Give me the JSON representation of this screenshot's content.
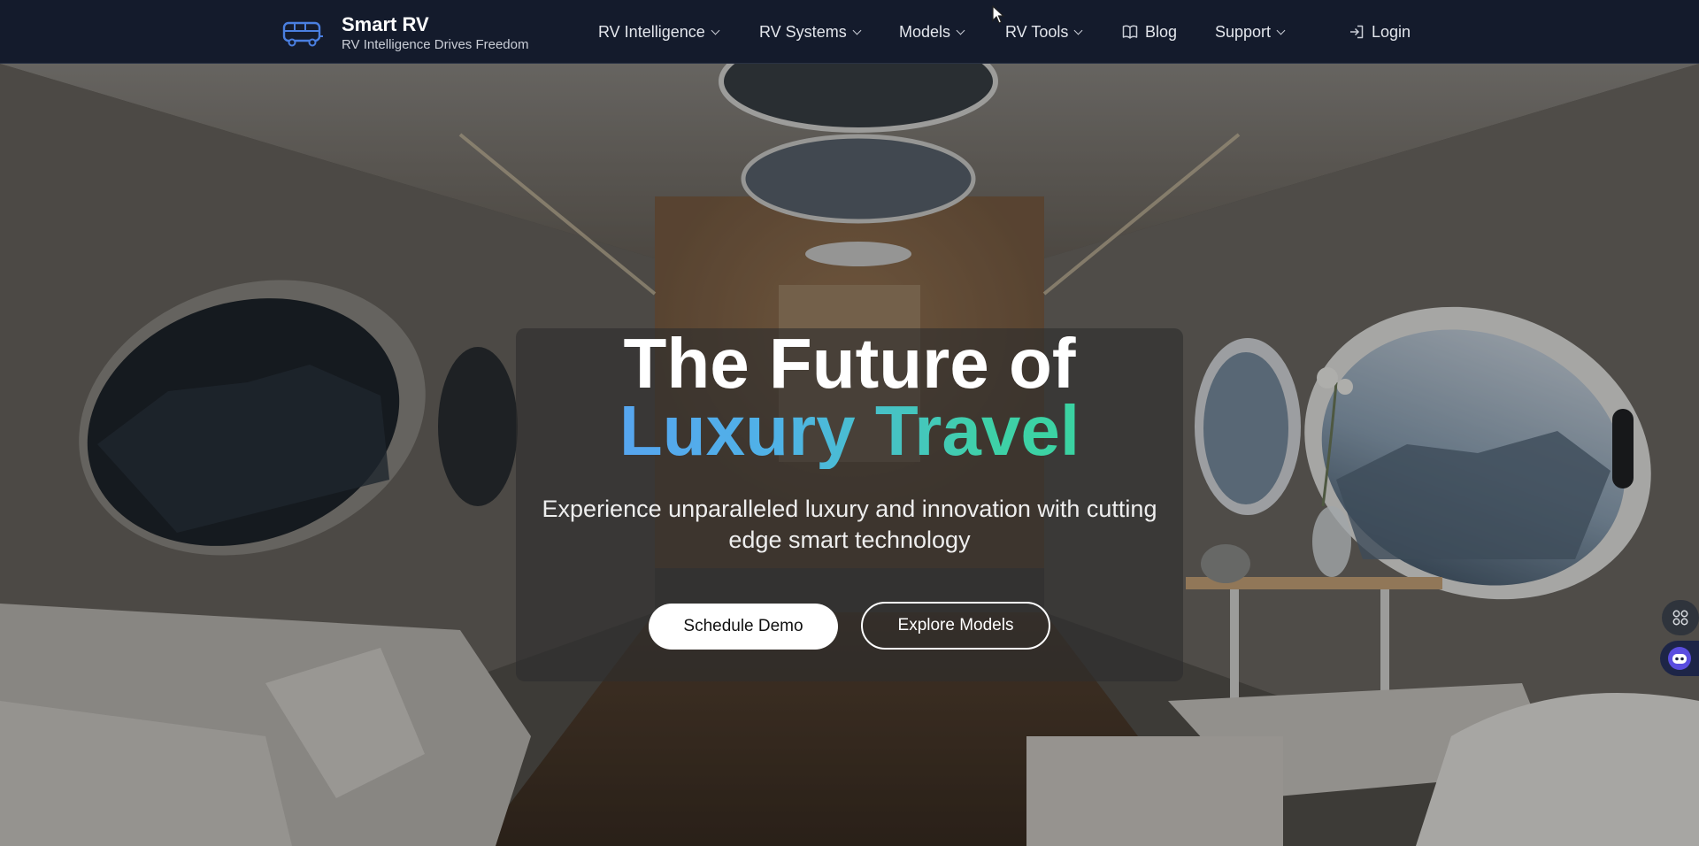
{
  "brand": {
    "title": "Smart RV",
    "tagline": "RV Intelligence Drives Freedom",
    "icon": "rv-bus-icon"
  },
  "nav": {
    "items": [
      {
        "label": "RV Intelligence",
        "has_dropdown": true
      },
      {
        "label": "RV Systems",
        "has_dropdown": true
      },
      {
        "label": "Models",
        "has_dropdown": true
      },
      {
        "label": "RV Tools",
        "has_dropdown": true
      },
      {
        "label": "Blog",
        "icon": "book-icon"
      },
      {
        "label": "Support",
        "has_dropdown": true
      }
    ],
    "login": {
      "label": "Login",
      "icon": "login-icon"
    }
  },
  "hero": {
    "headline_line1": "The Future of",
    "headline_line2": "Luxury Travel",
    "subtext": "Experience unparalleled luxury and innovation with cutting edge smart technology",
    "primary_button": "Schedule Demo",
    "secondary_button": "Explore Models",
    "background": "rv-interior-photo"
  },
  "floating_buttons": [
    {
      "icon": "apps-grid-icon"
    },
    {
      "icon": "chat-bot-icon"
    }
  ],
  "colors": {
    "header_bg": "#141b2c",
    "gradient_start": "#5b9cf5",
    "gradient_end": "#35d69b",
    "brand_icon": "#4a7fe0"
  }
}
